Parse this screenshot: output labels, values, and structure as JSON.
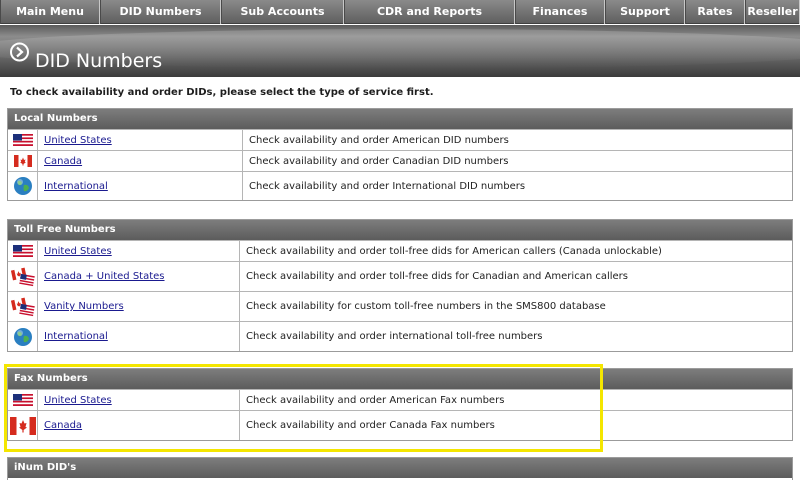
{
  "nav": {
    "items": [
      {
        "label": "Main Menu",
        "w": 100
      },
      {
        "label": "DID Numbers",
        "w": 121
      },
      {
        "label": "Sub Accounts",
        "w": 123
      },
      {
        "label": "CDR and Reports",
        "w": 171
      },
      {
        "label": "Finances",
        "w": 90
      },
      {
        "label": "Support",
        "w": 80
      },
      {
        "label": "Rates",
        "w": 60
      },
      {
        "label": "Reseller",
        "w": 55
      }
    ]
  },
  "page": {
    "title": "DID Numbers",
    "intro": "To check availability and order DIDs, please select the type of service first."
  },
  "sections": {
    "local": {
      "title": "Local Numbers",
      "rows": [
        {
          "icon": "us-flag-icon",
          "label": "United States",
          "desc": "Check availability and order American DID numbers"
        },
        {
          "icon": "canada-flag-icon",
          "label": "Canada",
          "desc": "Check availability and order Canadian DID numbers"
        },
        {
          "icon": "globe-icon",
          "label": "International",
          "desc": "Check availability and order International DID numbers"
        }
      ]
    },
    "tollfree": {
      "title": "Toll Free Numbers",
      "rows": [
        {
          "icon": "us-flag-icon",
          "label": "United States",
          "desc": "Check availability and order toll-free dids for American callers (Canada unlockable)"
        },
        {
          "icon": "canada-us-flag-icon",
          "label": "Canada + United States",
          "desc": "Check availability and order toll-free dids for Canadian and American callers"
        },
        {
          "icon": "canada-us-flag-icon",
          "label": "Vanity Numbers",
          "desc": "Check availability for custom toll-free numbers in the SMS800 database"
        },
        {
          "icon": "globe-icon",
          "label": "International",
          "desc": "Check availability and order international toll-free numbers"
        }
      ]
    },
    "fax": {
      "title": "Fax Numbers",
      "rows": [
        {
          "icon": "us-flag-icon",
          "label": "United States",
          "desc": "Check availability and order American Fax numbers"
        },
        {
          "icon": "canada-flag-icon",
          "label": "Canada",
          "desc": "Check availability and order Canada Fax numbers"
        }
      ]
    },
    "inum": {
      "title": "iNum DID's"
    }
  },
  "colors": {
    "highlight": "#f4e600",
    "link": "#1a1a8f",
    "header": "#6b6b6b"
  }
}
